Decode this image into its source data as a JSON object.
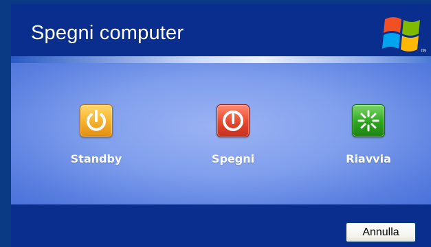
{
  "dialog": {
    "title": "Spegni computer"
  },
  "options": [
    {
      "label": "Standby",
      "icon": "power-standby-icon",
      "color": "#f5b12b"
    },
    {
      "label": "Spegni",
      "icon": "power-off-icon",
      "color": "#e4482e"
    },
    {
      "label": "Riavvia",
      "icon": "restart-icon",
      "color": "#2ea51f"
    }
  ],
  "footer": {
    "cancel_label": "Annulla"
  }
}
